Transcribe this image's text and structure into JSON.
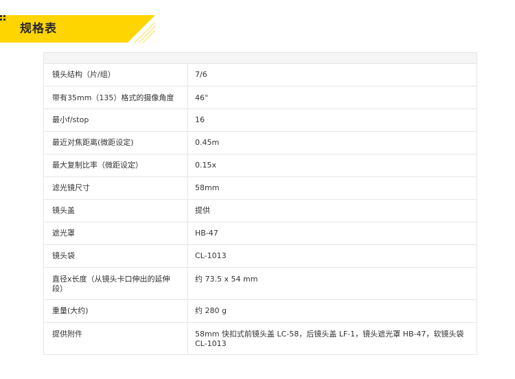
{
  "header": {
    "title": "规格表",
    "icon": "dots-bullet-icon",
    "accent_color": "#FFD500"
  },
  "specs": [
    {
      "label": "镜头结构（片/组）",
      "value": "7/6"
    },
    {
      "label": "带有35mm（135）格式的摄像角度",
      "value": "46°"
    },
    {
      "label": "最小f/stop",
      "value": "16"
    },
    {
      "label": "最近对焦距离(微距设定)",
      "value": "0.45m"
    },
    {
      "label": "最大复制比率（微距设定）",
      "value": "0.15x"
    },
    {
      "label": "滤光镜尺寸",
      "value": "58mm"
    },
    {
      "label": "镜头盖",
      "value": "提供"
    },
    {
      "label": "遮光罩",
      "value": "HB-47"
    },
    {
      "label": "镜头袋",
      "value": "CL-1013"
    },
    {
      "label": "直径x长度（从镜头卡口伸出的延伸段）",
      "value": "约 73.5 x 54 mm"
    },
    {
      "label": "重量(大约)",
      "value": "约 280 g"
    },
    {
      "label": "提供附件",
      "value": "58mm 快扣式前镜头盖 LC-58，后镜头盖 LF-1，镜头遮光罩 HB-47，软镜头袋 CL-1013"
    }
  ]
}
